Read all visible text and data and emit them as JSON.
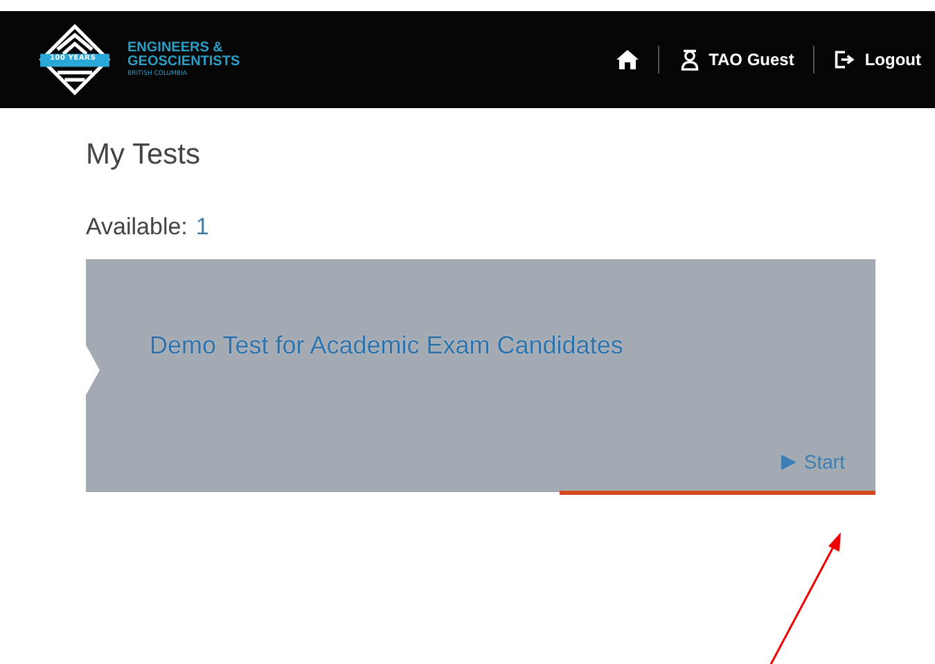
{
  "header": {
    "logo": {
      "badge": "100 YEARS",
      "line1": "ENGINEERS &",
      "line2": "GEOSCIENTISTS",
      "line3": "BRITISH COLUMBIA"
    },
    "user": "TAO Guest",
    "logout": "Logout"
  },
  "page_title": "My Tests",
  "available": {
    "label": "Available:",
    "count": "1"
  },
  "tests": [
    {
      "title": "Demo Test for Academic Exam Candidates",
      "action": "Start"
    }
  ]
}
